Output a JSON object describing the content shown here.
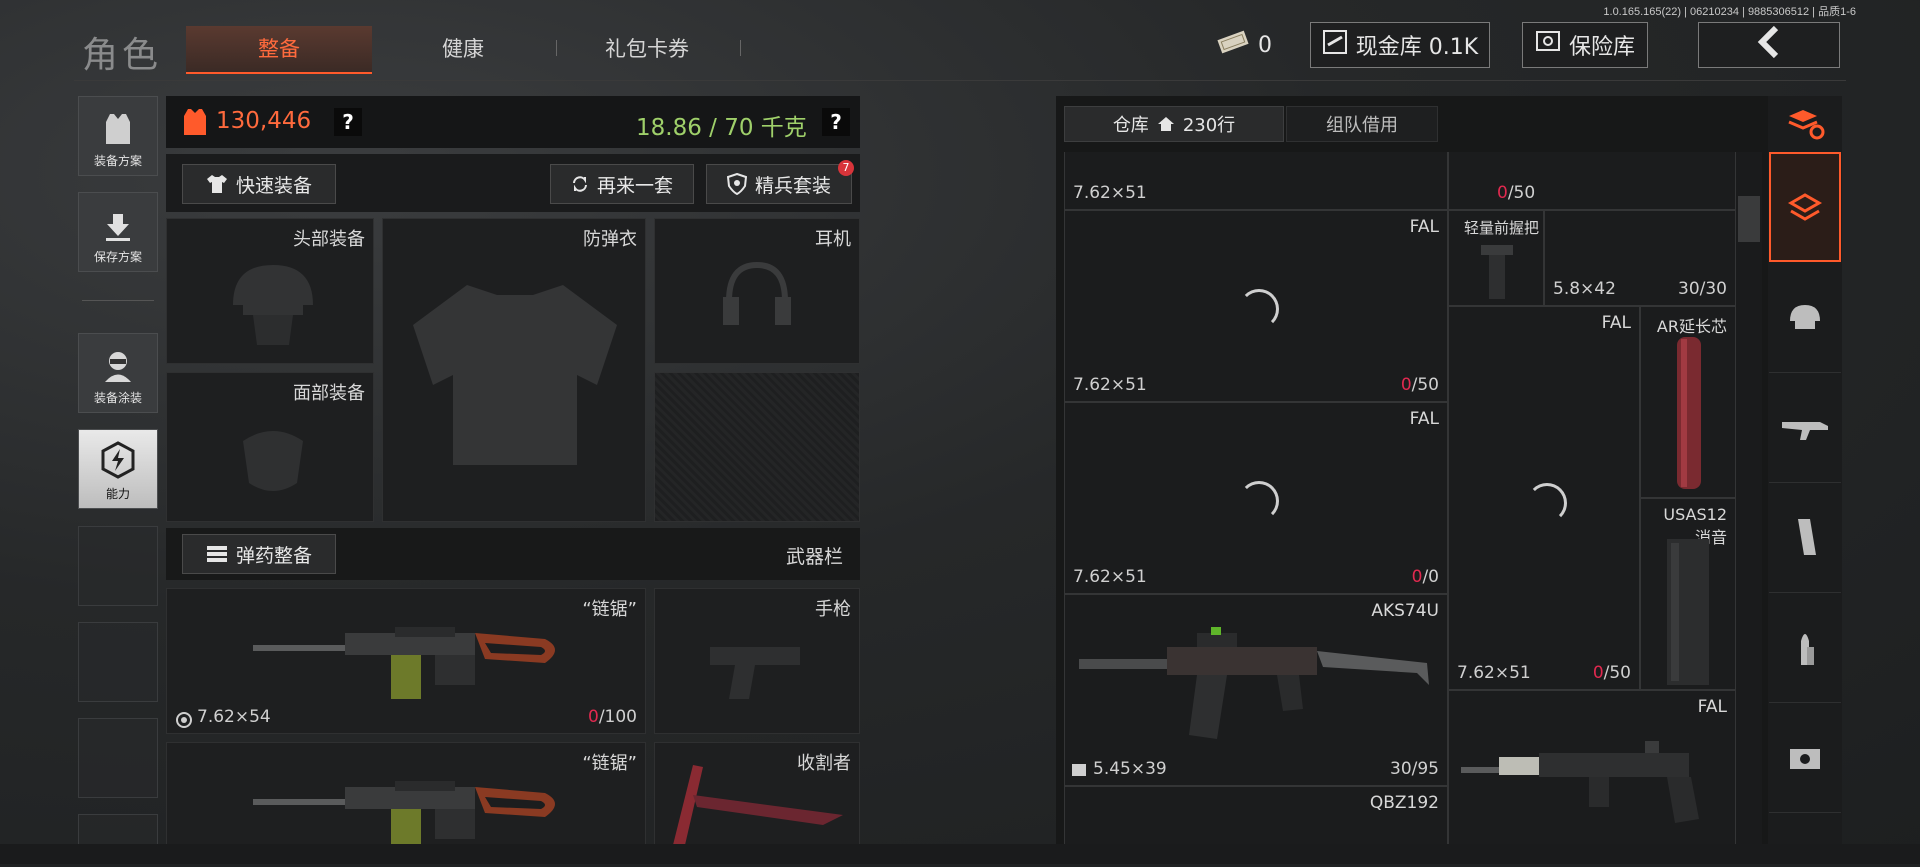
{
  "version": "1.0.165.165(22) | 06210234 | 9885306512 | 品质1-6",
  "header": {
    "title": "角色",
    "tabs": [
      {
        "label": "整备",
        "active": true
      },
      {
        "label": "健康",
        "active": false
      },
      {
        "label": "礼包卡券",
        "active": false
      }
    ],
    "ticket_count": "0",
    "cash_vault": "现金库 0.1K",
    "safe_vault": "保险库"
  },
  "rail": [
    {
      "label": "装备方案",
      "icon": "vest-icon"
    },
    {
      "label": "保存方案",
      "icon": "download-icon"
    },
    {
      "label": "装备涂装",
      "icon": "operator-icon"
    },
    {
      "label": "能力",
      "icon": "lightning-hex-icon",
      "active": true
    }
  ],
  "loadout": {
    "value": "130,446",
    "weight": "18.86 / 70 千克",
    "help": "?",
    "quick_equip": "快速装备",
    "again": "再来一套",
    "elite": "精兵套装",
    "elite_badge": "7",
    "slots": {
      "head": "头部装备",
      "armor": "防弹衣",
      "headset": "耳机",
      "face": "面部装备"
    },
    "ammo_prep": "弹药整备",
    "weapon_bar": "武器栏",
    "primary1": {
      "name": "“链锯”",
      "caliber": "7.62×54",
      "ammo_loaded": "0",
      "ammo_max": "/100"
    },
    "pistol": "手枪",
    "primary2": {
      "name": "“链锯”"
    },
    "melee": "收割者"
  },
  "warehouse": {
    "tab_storage": "仓库",
    "rows": "230行",
    "tab_team": "组队借用",
    "items": [
      {
        "id": "c1",
        "bottom_left": "7.62×51",
        "name": "",
        "ammo_loaded": "",
        "ammo_max": ""
      },
      {
        "id": "c2",
        "name": "",
        "ammo_loaded": "0",
        "ammo_max": "/50"
      },
      {
        "id": "fal1",
        "name": "FAL",
        "bottom_left": "7.62×51",
        "ammo_loaded": "0",
        "ammo_max": "/50"
      },
      {
        "id": "grip",
        "name": "轻量前握把",
        "bottom_left": "5.8×42",
        "ammo": "30/30"
      },
      {
        "id": "fal2",
        "name": "FAL",
        "bottom_left": "7.62×51",
        "ammo_loaded": "0",
        "ammo_max": "/0"
      },
      {
        "id": "fal3",
        "name": "FAL"
      },
      {
        "id": "ar-ext",
        "name": "AR延长芯"
      },
      {
        "id": "aks",
        "name": "AKS74U",
        "bottom_left": "5.45×39",
        "ammo": "30/95"
      },
      {
        "id": "usas",
        "name": "USAS12\n消音"
      },
      {
        "id": "fal4",
        "name": "",
        "bottom_left": "7.62×51",
        "ammo_loaded": "0",
        "ammo_max": "/50"
      },
      {
        "id": "fal5",
        "name": "FAL"
      },
      {
        "id": "qbz",
        "name": "QBZ192"
      }
    ]
  },
  "categories": [
    "sort-icon",
    "all-items-icon",
    "helmet-icon",
    "rifle-icon",
    "magazine-icon",
    "bullet-icon",
    "sight-icon"
  ]
}
